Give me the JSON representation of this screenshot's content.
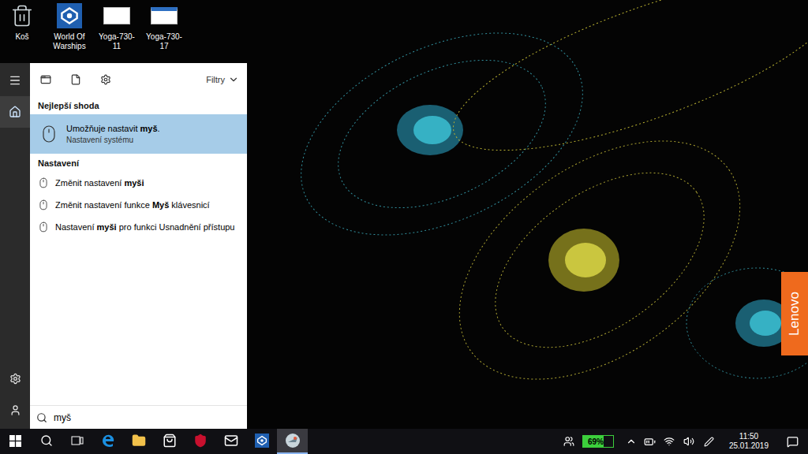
{
  "desktop": {
    "icons": [
      {
        "label": "Koš"
      },
      {
        "label": "World Of Warships"
      },
      {
        "label": "Yoga-730-11"
      },
      {
        "label": "Yoga-730-17"
      }
    ],
    "badge": "Lenovo"
  },
  "start": {
    "rail": {
      "top": [
        {
          "selected": false
        },
        {
          "selected": true
        }
      ],
      "bottom": [
        {
          "selected": false
        },
        {
          "selected": false
        }
      ]
    },
    "filters": "Filtry",
    "best_match": {
      "header": "Nejlepší shoda",
      "item": {
        "parts": [
          {
            "text": "Umožňuje nastavit ",
            "bold": false
          },
          {
            "text": "myš",
            "bold": true
          },
          {
            "text": ".",
            "bold": false
          }
        ],
        "subtitle": "Nastavení systému",
        "selected": true
      }
    },
    "settings": {
      "header": "Nastavení",
      "items": [
        {
          "parts": [
            {
              "text": "Změnit nastavení ",
              "bold": false
            },
            {
              "text": "myši",
              "bold": true
            }
          ],
          "selected": false
        },
        {
          "parts": [
            {
              "text": "Změnit nastavení funkce ",
              "bold": false
            },
            {
              "text": "Myš",
              "bold": true
            },
            {
              "text": " klávesnicí",
              "bold": false
            }
          ],
          "selected": false
        },
        {
          "parts": [
            {
              "text": "Nastavení ",
              "bold": false
            },
            {
              "text": "myši",
              "bold": true
            },
            {
              "text": " pro funkci Usnadnění přístupu",
              "bold": false
            }
          ],
          "selected": false
        }
      ]
    },
    "search": {
      "value": "myš"
    }
  },
  "taskbar": {
    "apps": [
      {
        "active": false
      },
      {
        "active": false
      },
      {
        "active": false
      },
      {
        "active": false
      },
      {
        "active": false
      },
      {
        "active": false
      },
      {
        "active": true
      }
    ],
    "battery": {
      "reading": "69%",
      "level": 0.69
    },
    "clock": {
      "time": "11:50",
      "date": "25.01.2019"
    }
  }
}
